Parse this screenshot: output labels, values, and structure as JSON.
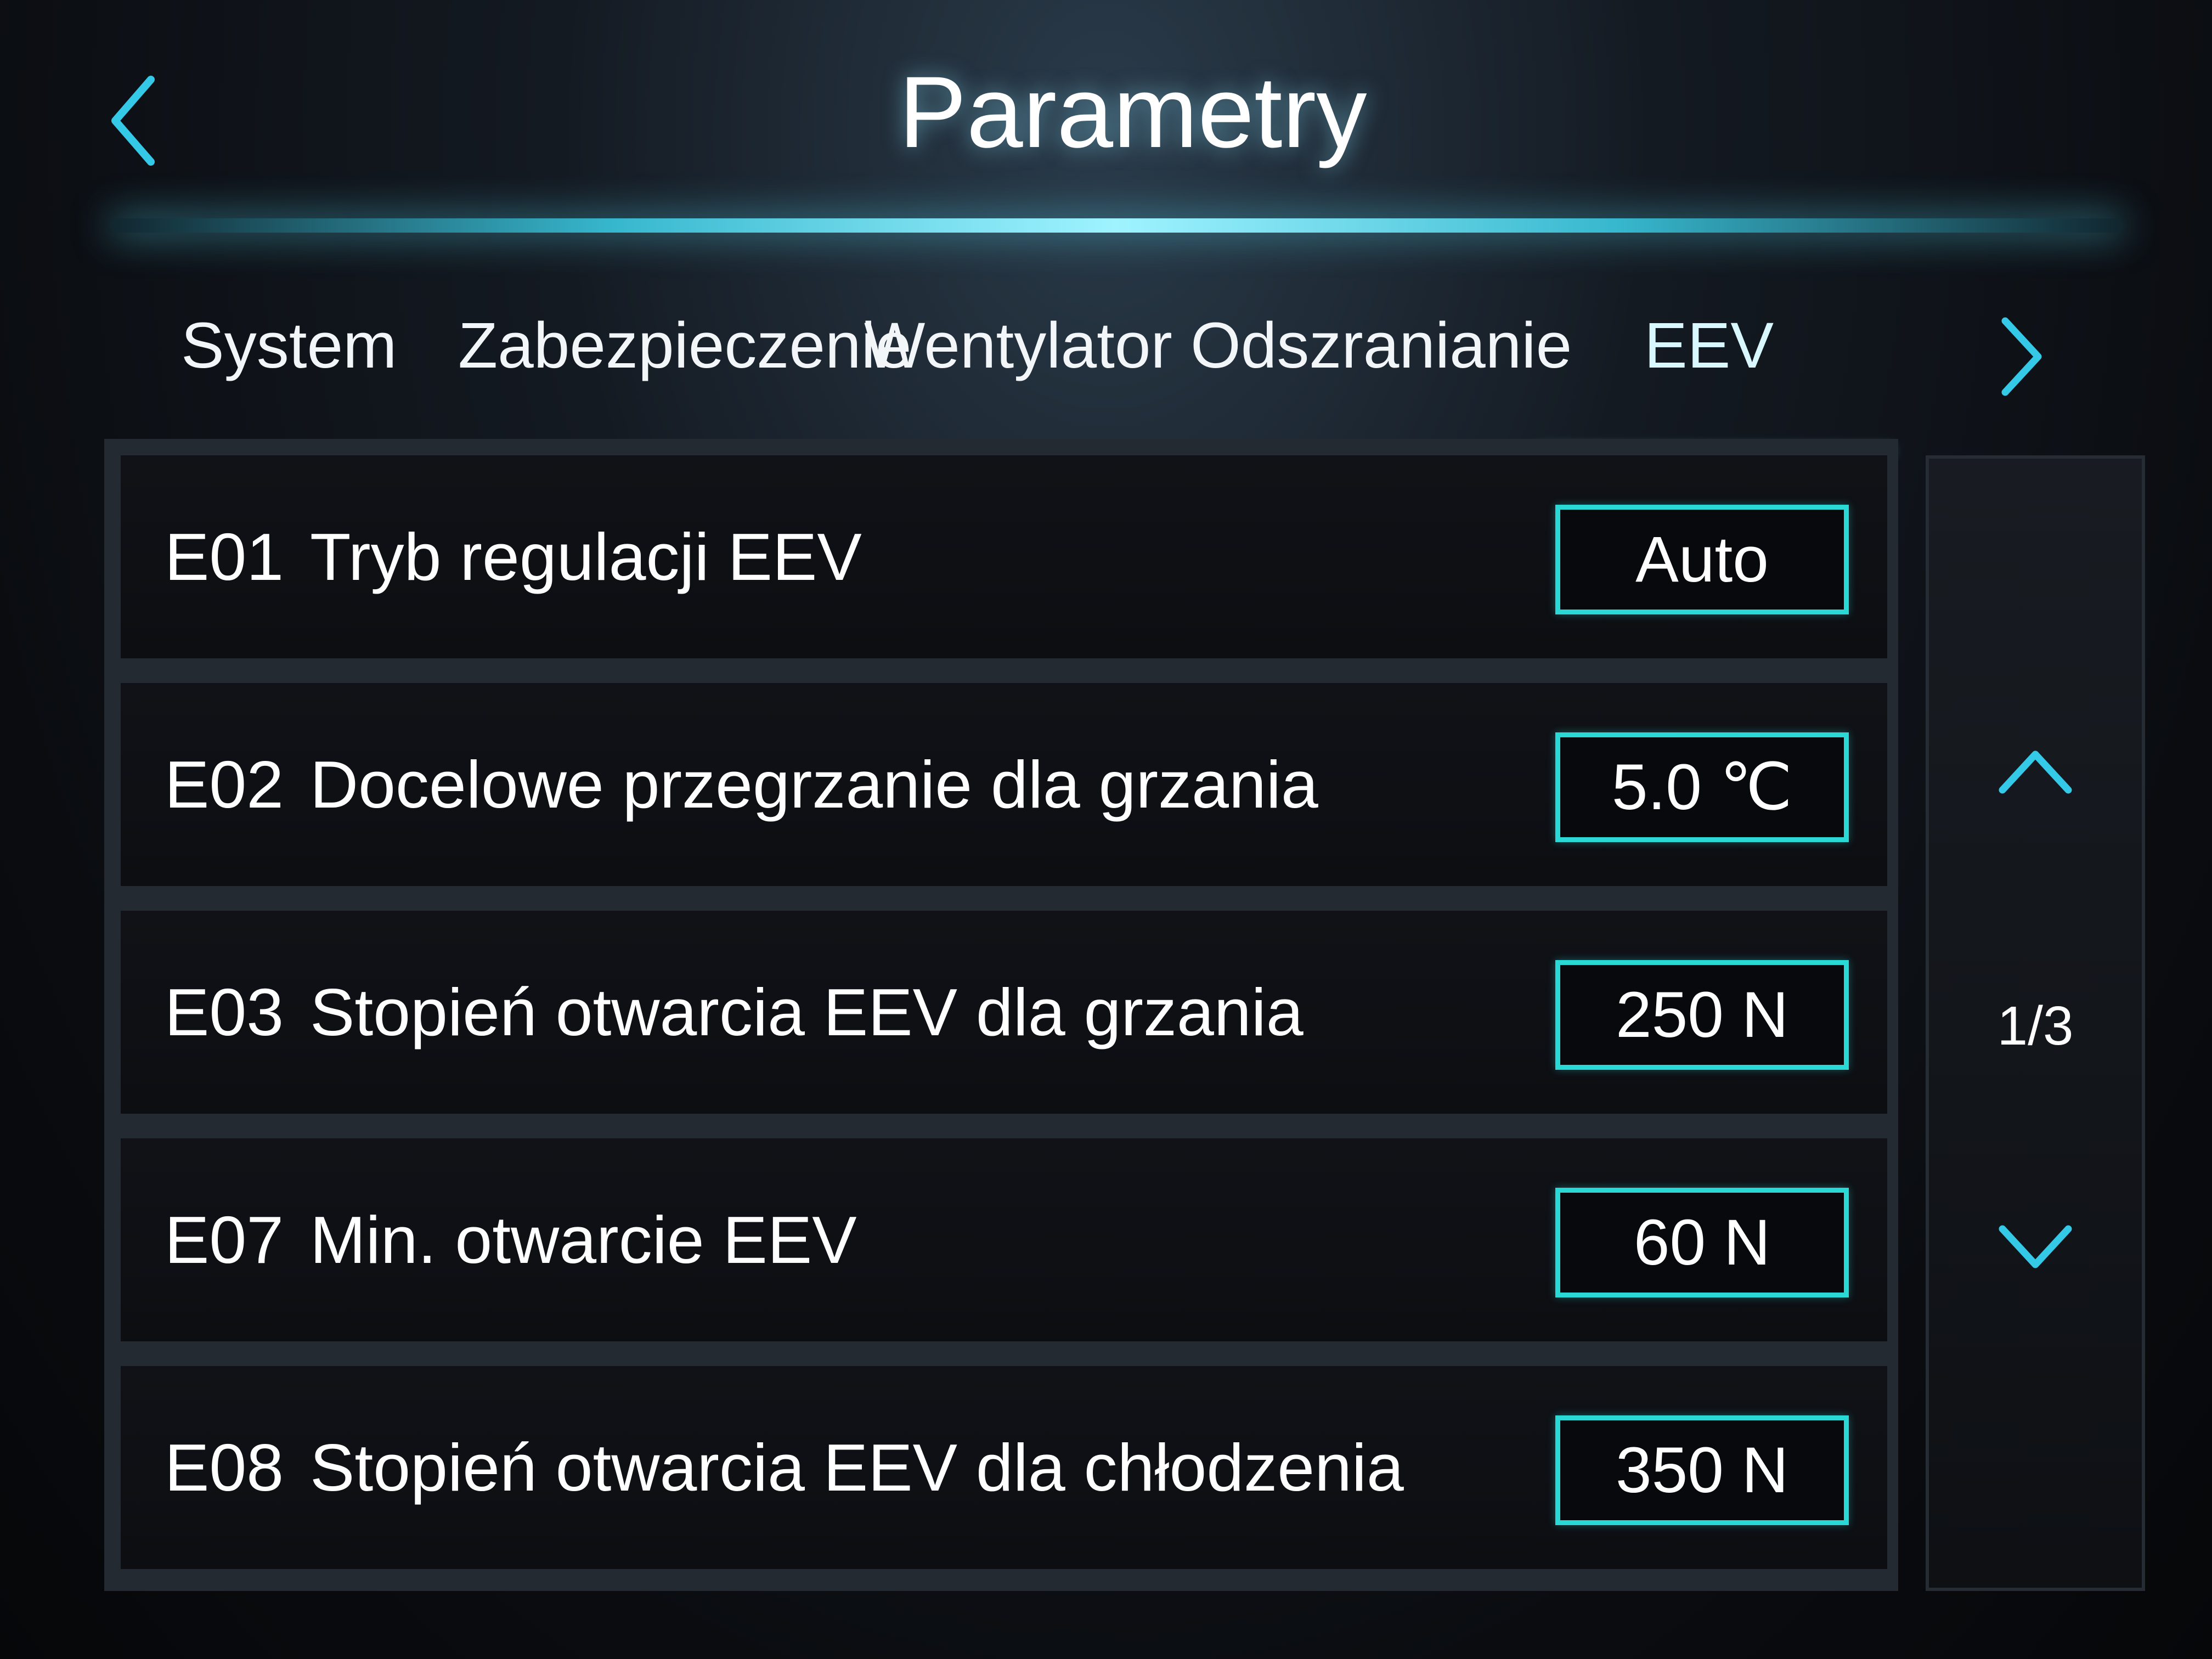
{
  "header": {
    "title": "Parametry"
  },
  "tabs": [
    {
      "label": "System",
      "active": false
    },
    {
      "label": "Zabezpieczenie",
      "active": false
    },
    {
      "label": "Wentylator",
      "active": false
    },
    {
      "label": "Odszranianie",
      "active": false
    },
    {
      "label": "EEV",
      "active": true
    }
  ],
  "parameters": [
    {
      "code": "E01",
      "label": "Tryb regulacji EEV",
      "value": "Auto"
    },
    {
      "code": "E02",
      "label": "Docelowe przegrzanie dla grzania",
      "value": "5.0 ℃"
    },
    {
      "code": "E03",
      "label": "Stopień otwarcia EEV dla grzania",
      "value": "250 N"
    },
    {
      "code": "E07",
      "label": "Min. otwarcie EEV",
      "value": "60 N"
    },
    {
      "code": "E08",
      "label": "Stopień otwarcia EEV dla chłodzenia",
      "value": "350 N"
    }
  ],
  "pager": {
    "indicator": "1/3"
  },
  "icons": {
    "back": "chevron-left-icon",
    "tabs_next": "chevron-right-icon",
    "page_up": "chevron-up-icon",
    "page_down": "chevron-down-icon"
  },
  "colors": {
    "accent": "#2ad8d6",
    "glow": "#9ff3ff",
    "text": "#ffffff",
    "background": "#0b0d12"
  }
}
